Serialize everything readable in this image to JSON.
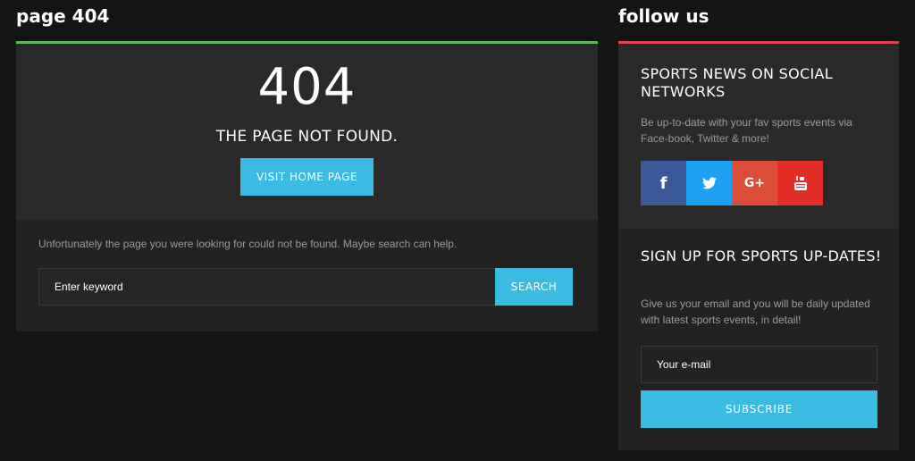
{
  "left": {
    "title": "page 404",
    "accent_color": "#5cb85c",
    "big_code": "404",
    "heading": "THE PAGE NOT FOUND.",
    "home_button": "VISIT HOME PAGE",
    "message": "Unfortunately the page you were looking for could not be found. Maybe search can help.",
    "search_placeholder": "Enter keyword",
    "search_button": "SEARCH"
  },
  "right": {
    "title": "follow us",
    "accent_color": "#e5444c",
    "social": {
      "heading": "SPORTS NEWS ON SOCIAL NETWORKS",
      "text": "Be up-to-date with your fav sports events via Face-book, Twitter & more!",
      "buttons": [
        {
          "name": "facebook",
          "icon": "facebook-icon",
          "glyph": "f",
          "color": "#3b5998"
        },
        {
          "name": "twitter",
          "icon": "twitter-icon",
          "glyph": "",
          "color": "#1da1f2"
        },
        {
          "name": "google-plus",
          "icon": "google-plus-icon",
          "glyph": "G+",
          "color": "#dd4b39"
        },
        {
          "name": "youtube",
          "icon": "youtube-icon",
          "glyph": "You Tube",
          "color": "#e52d27"
        }
      ]
    },
    "signup": {
      "heading": "SIGN UP FOR SPORTS UP-DATES!",
      "text": "Give us your email and you will be daily updated with latest sports events, in detail!",
      "email_placeholder": "Your e-mail",
      "subscribe_button": "SUBSCRIBE"
    }
  },
  "theme": {
    "accent_blue": "#3bbbe2",
    "background": "#141414"
  }
}
